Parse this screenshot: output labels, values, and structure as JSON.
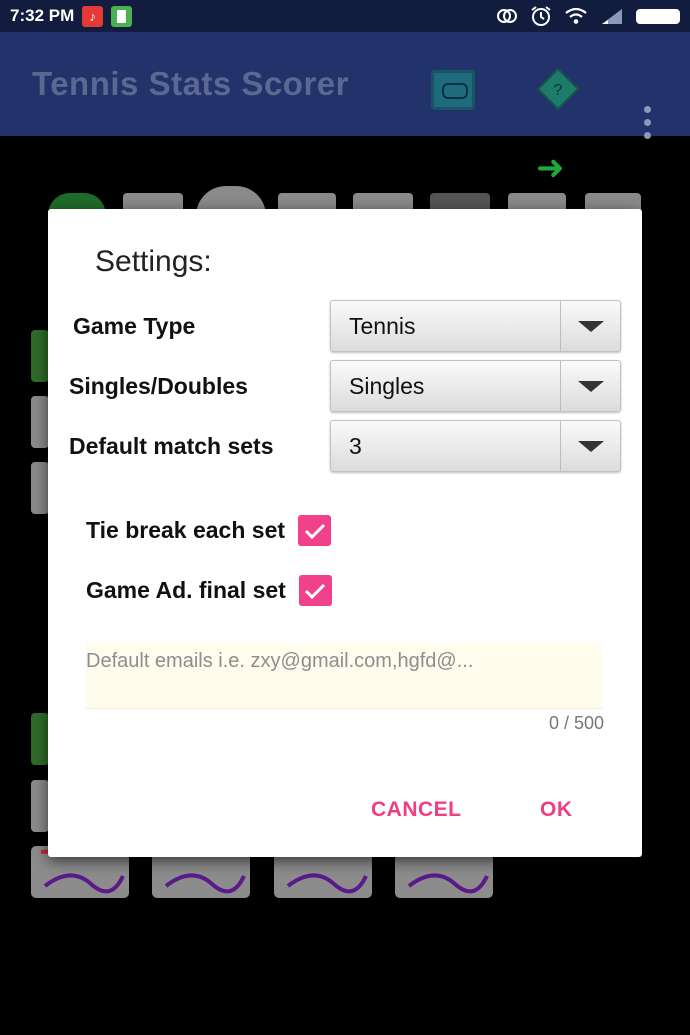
{
  "status_bar": {
    "time": "7:32 PM"
  },
  "app_bar": {
    "title": "Tennis Stats Scorer",
    "icons": [
      "stats-icon",
      "help-diamond-icon",
      "overflow-menu-icon"
    ]
  },
  "dialog": {
    "title": "Settings:",
    "game_type": {
      "label": "Game Type",
      "value": "Tennis"
    },
    "singles_doubles": {
      "label": "Singles/Doubles",
      "value": "Singles"
    },
    "match_sets": {
      "label": "Default match sets",
      "value": "3"
    },
    "tie_break": {
      "label": "Tie break each set",
      "checked": true
    },
    "game_ad": {
      "label": "Game Ad. final set",
      "checked": true
    },
    "emails": {
      "placeholder": "Default emails i.e. zxy@gmail.com,hgfd@...",
      "value": "",
      "counter": "0 / 500"
    },
    "cancel_label": "CANCEL",
    "ok_label": "OK"
  },
  "colors": {
    "app_bar": "#22336b",
    "status_bar": "#121c3f",
    "accent": "#ef3f84",
    "checkbox": "#f0418a"
  }
}
